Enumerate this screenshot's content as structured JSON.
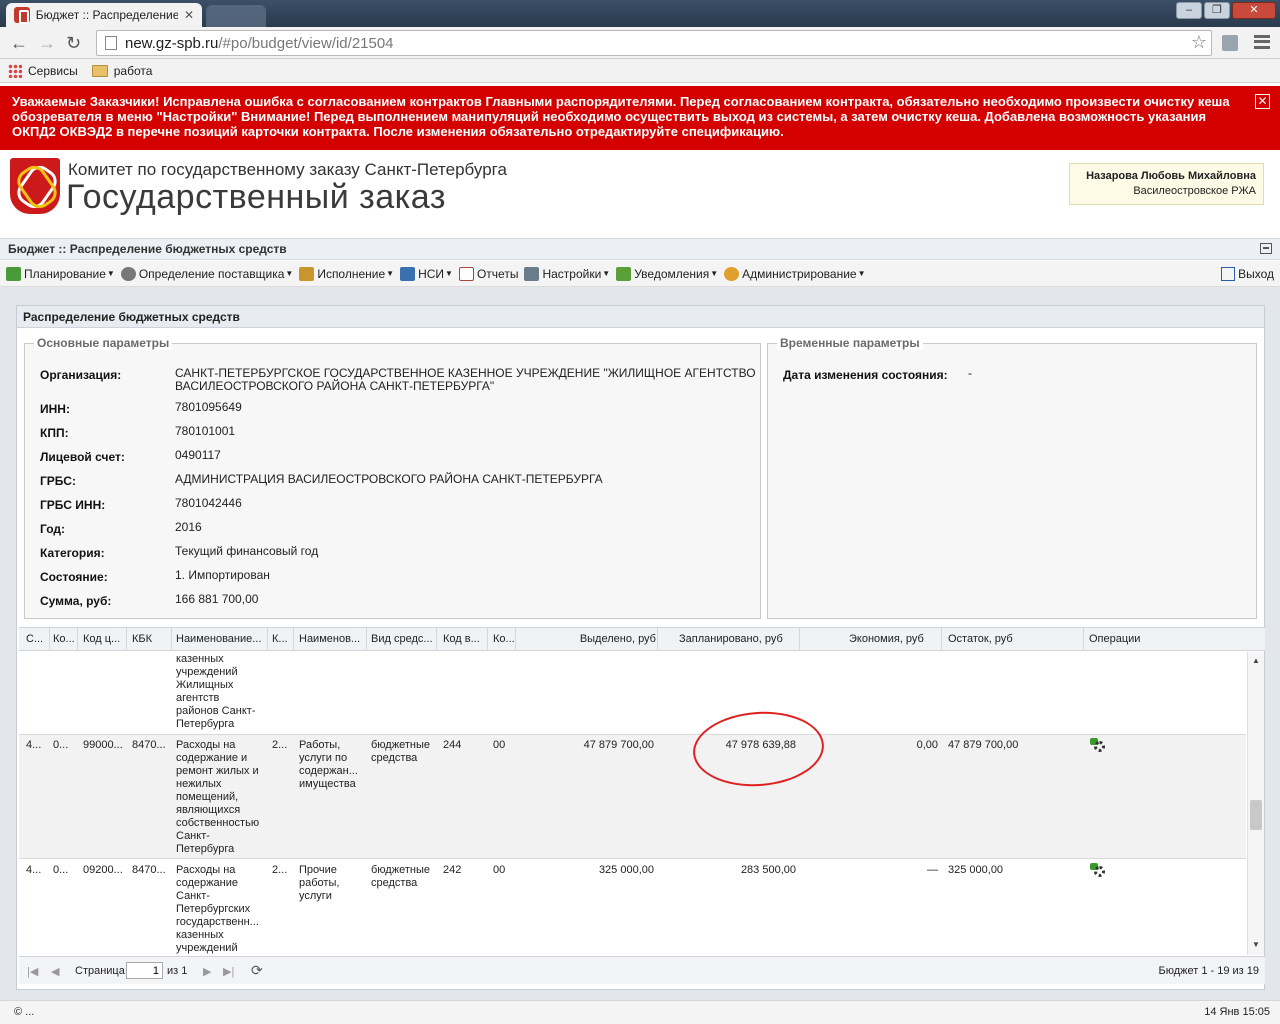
{
  "browser": {
    "tab_title": "Бюджет :: Распределение",
    "url_host": "new.gz-spb.ru",
    "url_path": "/#po/budget/view/id/21504",
    "bookmarks": [
      "Сервисы",
      "работа"
    ]
  },
  "banner": {
    "text": "Уважаемые Заказчики! Исправлена ошибка с согласованием контрактов Главными распорядителями. Перед согласованием контракта, обязательно необходимо произвести очистку кеша обозревателя в меню \"Настройки\" Внимание! Перед выполнением манипуляций необходимо осуществить выход из системы, а затем очистку кеша. Добавлена возможность указания ОКПД2 ОКВЭД2 в перечне позиций карточки контракта. После изменения обязательно отредактируйте спецификацию.",
    "close": "✕"
  },
  "header": {
    "org_sub": "Комитет по государственному заказу Санкт-Петербурга",
    "org_main": "Государственный заказ",
    "user_name": "Назарова Любовь Михайловна",
    "user_dept": "Василеостровское РЖА"
  },
  "panel_title": "Бюджет :: Распределение бюджетных средств",
  "menu": {
    "items": [
      "Планирование",
      "Определение поставщика",
      "Исполнение",
      "НСИ",
      "Отчеты",
      "Настройки",
      "Уведомления",
      "Администрирование"
    ],
    "exit": "Выход"
  },
  "subpanel_title": "Распределение бюджетных средств",
  "main_params": {
    "legend": "Основные параметры",
    "fields": [
      {
        "label": "Организация:",
        "value": "САНКТ-ПЕТЕРБУРГСКОЕ ГОСУДАРСТВЕННОЕ КАЗЕННОЕ УЧРЕЖДЕНИЕ \"ЖИЛИЩНОЕ АГЕНТСТВО"
      },
      {
        "label": "ИНН:",
        "value": "7801095649"
      },
      {
        "label": "КПП:",
        "value": "780101001"
      },
      {
        "label": "Лицевой счет:",
        "value": "0490117"
      },
      {
        "label": "ГРБС:",
        "value": "АДМИНИСТРАЦИЯ ВАСИЛЕОСТРОВСКОГО РАЙОНА САНКТ-ПЕТЕРБУРГА"
      },
      {
        "label": "ГРБС ИНН:",
        "value": "7801042446"
      },
      {
        "label": "Год:",
        "value": "2016"
      },
      {
        "label": "Категория:",
        "value": "Текущий финансовый год"
      },
      {
        "label": "Состояние:",
        "value": "1. Импортирован"
      },
      {
        "label": "Сумма, руб:",
        "value": "166 881 700,00"
      }
    ],
    "org_line2": "ВАСИЛЕОСТРОВСКОГО РАЙОНА САНКТ-ПЕТЕРБУРГА\""
  },
  "time_params": {
    "legend": "Временные параметры",
    "label": "Дата изменения состояния:",
    "value": "-"
  },
  "grid": {
    "columns": [
      "С...",
      "Ко...",
      "Код ц...",
      "КБК",
      "Наименование...",
      "К...",
      "Наименов...",
      "Вид средс...",
      "Код в...",
      "Ко...",
      "Выделено, руб",
      "Запланировано, руб",
      "Экономия, руб",
      "Остаток, руб",
      "Операции"
    ],
    "partial_row": [
      "казенных",
      "учреждений",
      "Жилищных",
      "агентств",
      "районов Санкт-",
      "Петербурга"
    ],
    "rows": [
      {
        "c1": "4...",
        "c2": "0...",
        "c3": "99000...",
        "c4": "8470...",
        "name": [
          "Расходы на",
          "содержание и",
          "ремонт жилых и",
          "нежилых",
          "помещений,",
          "являющихся",
          "собственностью",
          "Санкт-",
          "Петербурга"
        ],
        "c6": "2...",
        "name2": [
          "Работы,",
          "услуги по",
          "содержан...",
          "имущества"
        ],
        "vid": [
          "бюджетные",
          "средства"
        ],
        "kodv": "244",
        "ko": "00",
        "allocated": "47 879 700,00",
        "planned": "47 978 639,88",
        "economy": "0,00",
        "rest": "47 879 700,00"
      },
      {
        "c1": "4...",
        "c2": "0...",
        "c3": "09200...",
        "c4": "8470...",
        "name": [
          "Расходы на",
          "содержание",
          "Санкт-",
          "Петербургских",
          "государственн...",
          "казенных",
          "учреждений"
        ],
        "c6": "2...",
        "name2": [
          "Прочие",
          "работы,",
          "услуги"
        ],
        "vid": [
          "бюджетные",
          "средства"
        ],
        "kodv": "242",
        "ko": "00",
        "allocated": "325 000,00",
        "planned": "283 500,00",
        "economy": "—",
        "rest": "325 000,00"
      }
    ]
  },
  "pager": {
    "page_label": "Страница",
    "page_value": "1",
    "of": "из 1",
    "summary": "Бюджет 1 - 19 из 19"
  },
  "status": {
    "left": "© ...",
    "right": "14 Янв 15:05"
  }
}
